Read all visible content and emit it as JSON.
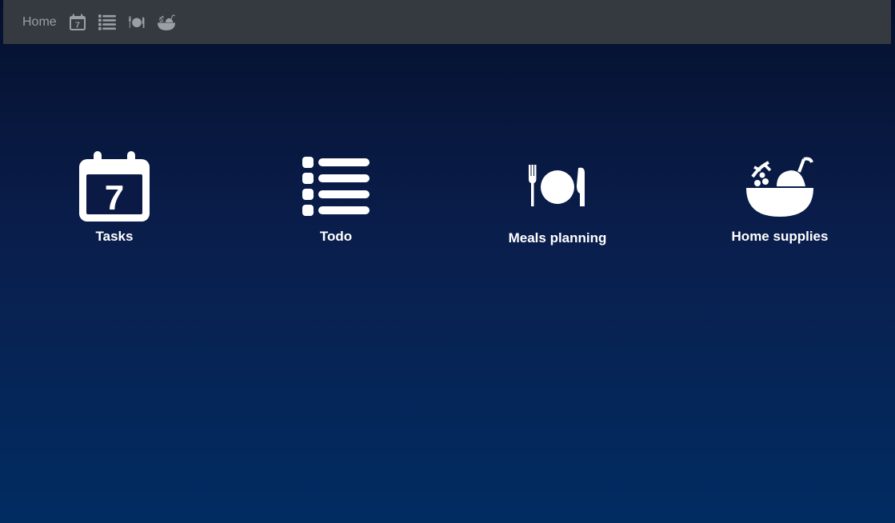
{
  "nav": {
    "home_label": "Home",
    "icons": [
      "calendar-icon",
      "list-icon",
      "plate-cutlery-icon",
      "bowl-food-icon"
    ],
    "text_color": "#9a9fa4",
    "background": "#343a40"
  },
  "tiles": [
    {
      "label": "Tasks",
      "icon": "calendar-icon",
      "calendar_day": "7"
    },
    {
      "label": "Todo",
      "icon": "list-icon"
    },
    {
      "label": "Meals planning",
      "icon": "plate-cutlery-icon"
    },
    {
      "label": "Home supplies",
      "icon": "bowl-food-icon"
    }
  ],
  "colors": {
    "bg_top": "#05102d",
    "bg_bottom": "#012c62",
    "tile_foreground": "#ffffff"
  }
}
